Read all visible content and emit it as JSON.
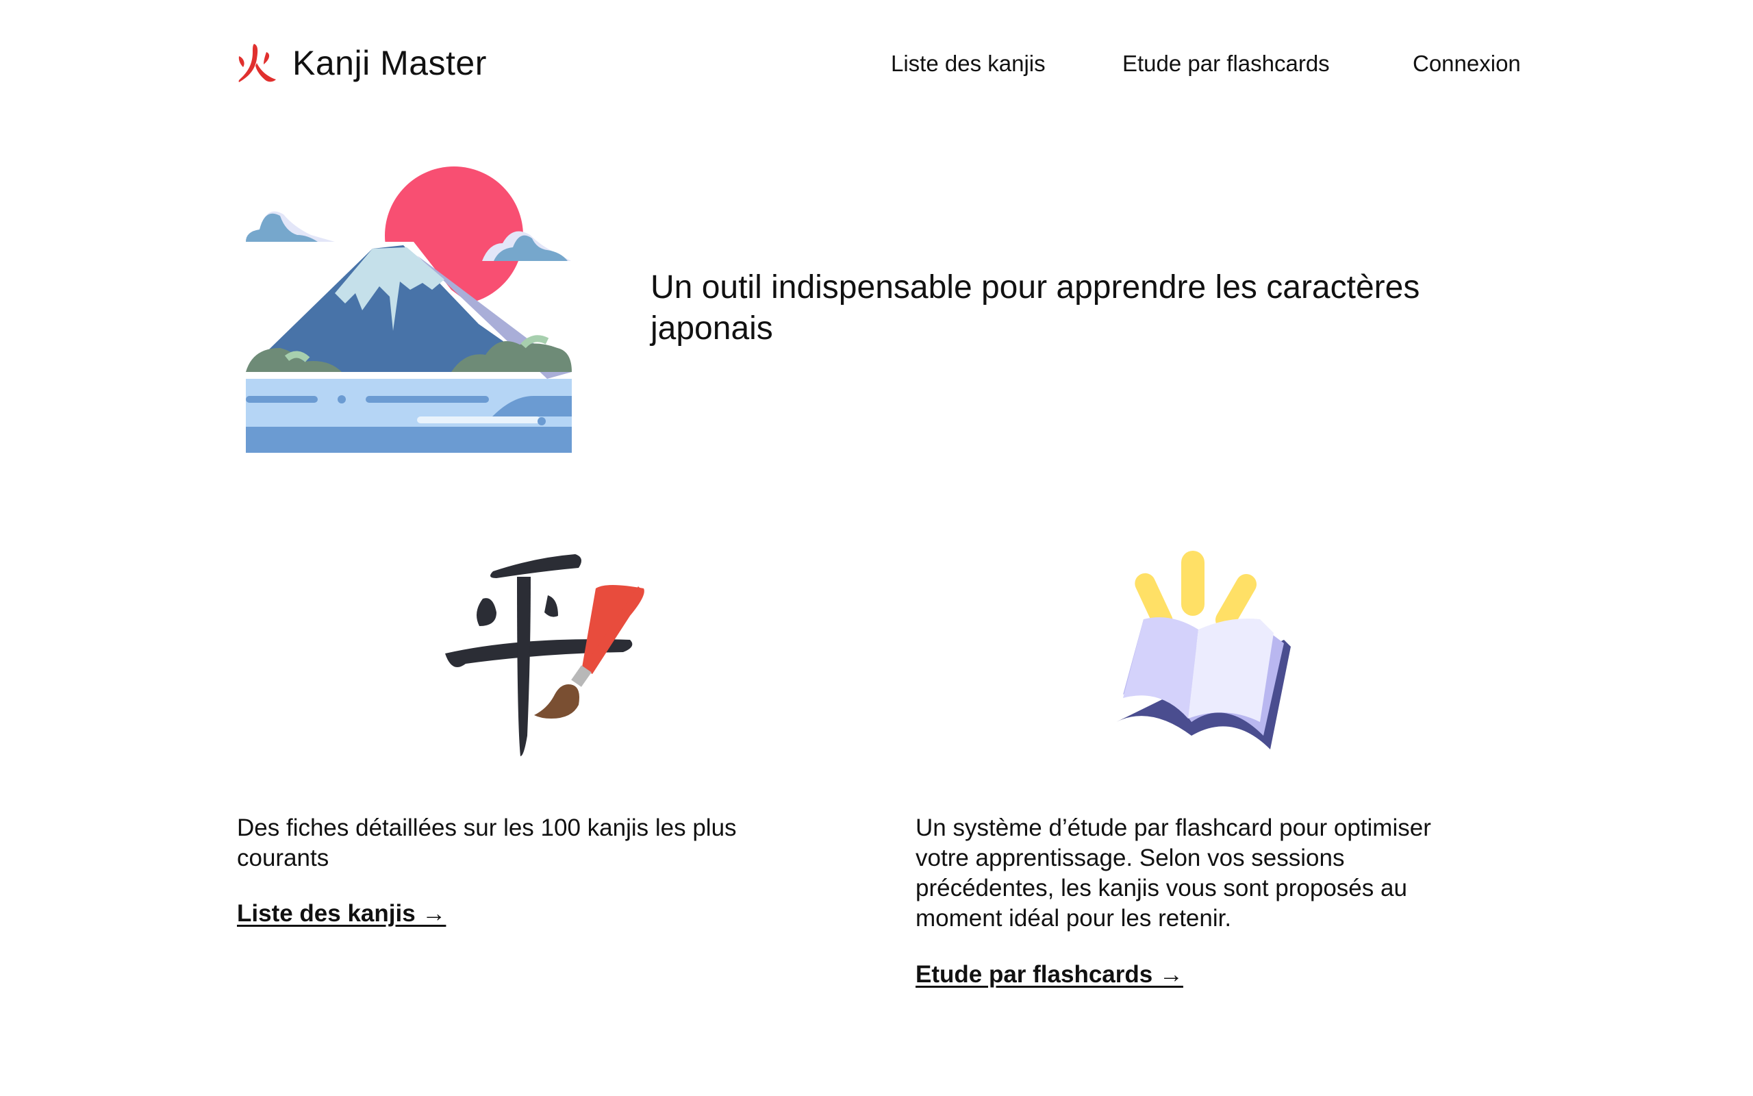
{
  "header": {
    "logo_text": "Kanji Master",
    "logo_glyph": "火",
    "nav": [
      {
        "label": "Liste des kanjis"
      },
      {
        "label": "Etude par flashcards"
      },
      {
        "label": "Connexion"
      }
    ]
  },
  "hero": {
    "title": "Un outil indispensable pour apprendre les caractères japonais",
    "illustration": "mount-fuji-sun-illustration"
  },
  "features": [
    {
      "illustration": "kanji-brush-illustration",
      "text": "Des fiches détaillées sur les 100 kanjis les plus courants",
      "link": "Liste des kanjis →"
    },
    {
      "illustration": "open-book-illustration",
      "text": "Un système d’étude par flashcard pour optimiser votre apprentissage. Selon vos sessions précédentes, les kanjis vous sont proposés au moment idéal pour les retenir.",
      "link": "Etude par flashcards →"
    }
  ],
  "colors": {
    "brand_red": "#e0302e",
    "sun": "#f84f72",
    "text": "#111111"
  }
}
